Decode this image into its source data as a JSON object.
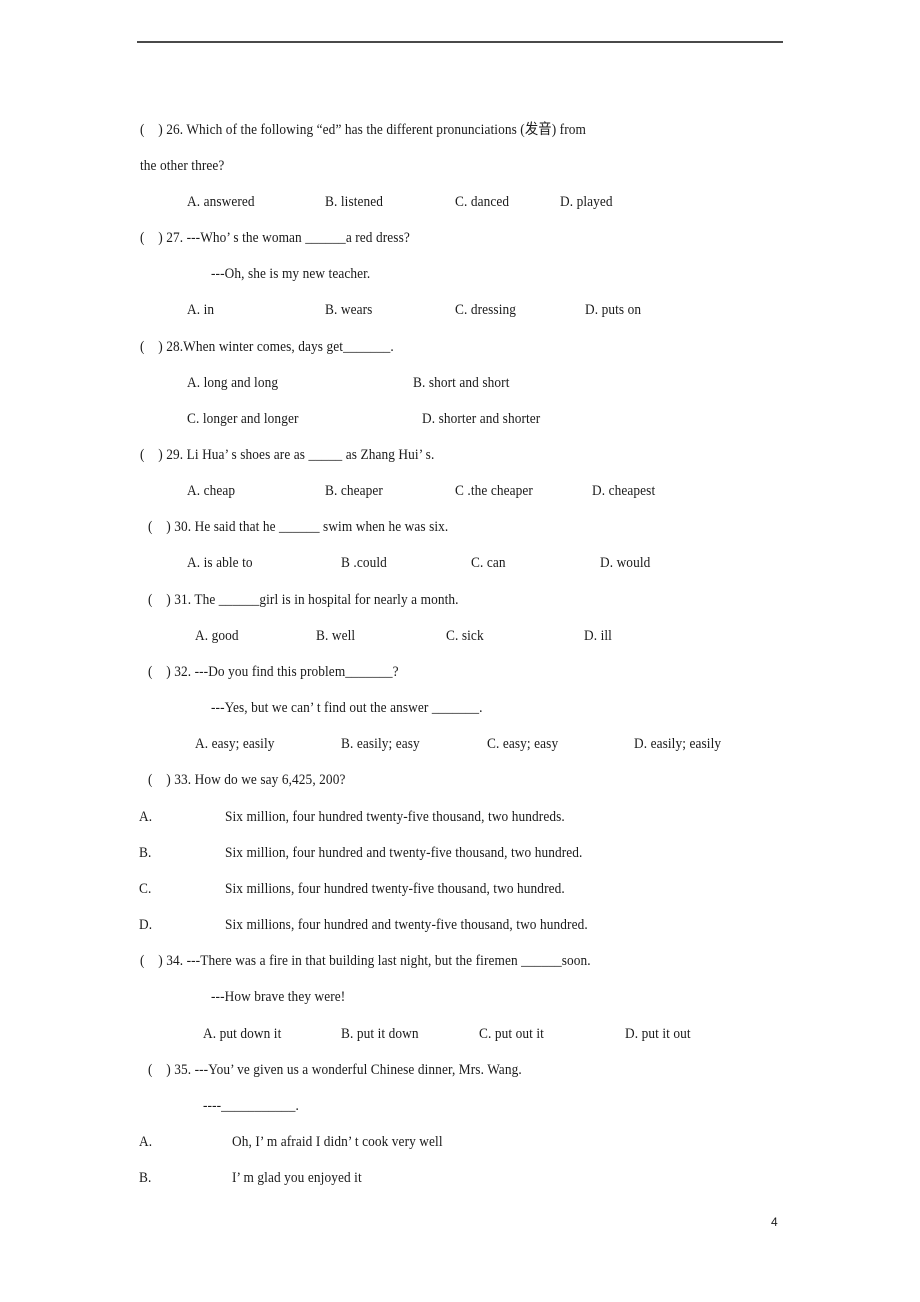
{
  "page_number": "4",
  "questions": [
    {
      "number": "26",
      "paren": "(    )",
      "stem_line1": "26. Which of the following “ed” has the different pronunciations (发音) from",
      "stem_line2": "the other three?",
      "options": [
        "A. answered",
        "B. listened",
        "C. danced",
        "D. played"
      ]
    },
    {
      "number": "27",
      "paren": "(    )",
      "stem_line1": "27. ---Who’ s the woman ______a red dress?",
      "stem_line2": "---Oh, she is my new teacher.",
      "options": [
        "A. in",
        "B. wears",
        "C. dressing",
        "D. puts on"
      ]
    },
    {
      "number": "28",
      "paren": "(    )",
      "stem_line1": "28.When winter comes, days get_______.",
      "options": [
        "A. long and long",
        "B. short and short",
        "C. longer and longer",
        "D. shorter and shorter"
      ]
    },
    {
      "number": "29",
      "paren": "(    )",
      "stem_line1": "29. Li Hua’ s shoes are as _____ as Zhang Hui’ s.",
      "options": [
        "A. cheap",
        "B. cheaper",
        "C .the cheaper",
        "D. cheapest"
      ]
    },
    {
      "number": "30",
      "paren": "(    )",
      "stem_line1": "30. He said that he ______ swim when he was six.",
      "options": [
        "A. is able to",
        "B .could",
        "C. can",
        "D. would"
      ]
    },
    {
      "number": "31",
      "paren": "(    )",
      "stem_line1": "31. The ______girl is in hospital for nearly a month.",
      "options": [
        "A. good",
        "B. well",
        "C. sick",
        "D. ill"
      ]
    },
    {
      "number": "32",
      "paren": "(    )",
      "stem_line1": "32. ---Do you find this problem_______?",
      "stem_line2": "---Yes, but we can’ t find out the answer _______.",
      "options": [
        "A. easy; easily",
        "B. easily; easy",
        "C. easy; easy",
        "D. easily; easily"
      ]
    },
    {
      "number": "33",
      "paren": "(    )",
      "stem_line1": "33. How do we say 6,425, 200?",
      "options": [
        {
          "letter": "A.",
          "text": "Six million, four hundred twenty-five thousand, two hundreds."
        },
        {
          "letter": "B.",
          "text": "Six million, four hundred and twenty-five thousand, two hundred."
        },
        {
          "letter": "C.",
          "text": "Six millions, four hundred twenty-five thousand, two hundred."
        },
        {
          "letter": "D.",
          "text": "Six millions, four hundred and twenty-five thousand, two hundred."
        }
      ]
    },
    {
      "number": "34",
      "paren": "(    )",
      "stem_line1": "34. ---There was a fire in that building last night, but the firemen ______soon.",
      "stem_line2": "---How brave they were!",
      "options": [
        "A. put down it",
        "B. put it down",
        "C. put out it",
        "D. put it out"
      ]
    },
    {
      "number": "35",
      "paren": "(    )",
      "stem_line1": "35. ---You’ ve given us a wonderful Chinese dinner, Mrs. Wang.",
      "stem_line2": "----___________.",
      "options": [
        {
          "letter": "A.",
          "text": "Oh, I’ m afraid I didn’ t cook very well"
        },
        {
          "letter": "B.",
          "text": "I’ m glad you enjoyed it"
        }
      ]
    }
  ]
}
